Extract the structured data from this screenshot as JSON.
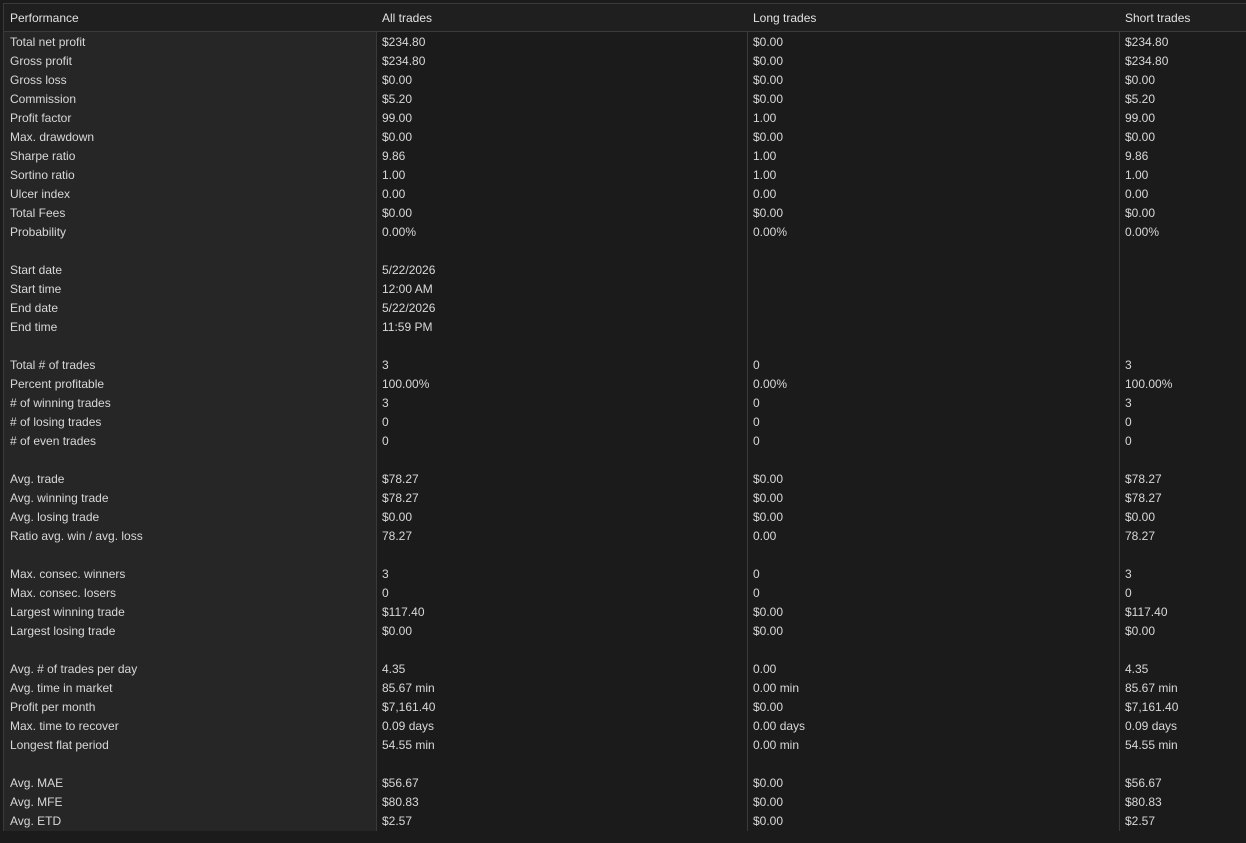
{
  "headers": [
    "Performance",
    "All trades",
    "Long trades",
    "Short trades"
  ],
  "rows": [
    [
      "Total net profit",
      "$234.80",
      "$0.00",
      "$234.80"
    ],
    [
      "Gross profit",
      "$234.80",
      "$0.00",
      "$234.80"
    ],
    [
      "Gross loss",
      "$0.00",
      "$0.00",
      "$0.00"
    ],
    [
      "Commission",
      "$5.20",
      "$0.00",
      "$5.20"
    ],
    [
      "Profit factor",
      "99.00",
      "1.00",
      "99.00"
    ],
    [
      "Max. drawdown",
      "$0.00",
      "$0.00",
      "$0.00"
    ],
    [
      "Sharpe ratio",
      "9.86",
      "1.00",
      "9.86"
    ],
    [
      "Sortino ratio",
      "1.00",
      "1.00",
      "1.00"
    ],
    [
      "Ulcer index",
      "0.00",
      "0.00",
      "0.00"
    ],
    [
      "Total Fees",
      "$0.00",
      "$0.00",
      "$0.00"
    ],
    [
      "Probability",
      "0.00%",
      "0.00%",
      "0.00%"
    ],
    [
      "",
      "",
      "",
      ""
    ],
    [
      "Start date",
      "5/22/2026",
      "",
      ""
    ],
    [
      "Start time",
      "12:00 AM",
      "",
      ""
    ],
    [
      "End date",
      "5/22/2026",
      "",
      ""
    ],
    [
      "End time",
      "11:59 PM",
      "",
      ""
    ],
    [
      "",
      "",
      "",
      ""
    ],
    [
      "Total # of trades",
      "3",
      "0",
      "3"
    ],
    [
      "Percent profitable",
      "100.00%",
      "0.00%",
      "100.00%"
    ],
    [
      "# of winning trades",
      "3",
      "0",
      "3"
    ],
    [
      "# of losing trades",
      "0",
      "0",
      "0"
    ],
    [
      "# of even trades",
      "0",
      "0",
      "0"
    ],
    [
      "",
      "",
      "",
      ""
    ],
    [
      "Avg. trade",
      "$78.27",
      "$0.00",
      "$78.27"
    ],
    [
      "Avg. winning trade",
      "$78.27",
      "$0.00",
      "$78.27"
    ],
    [
      "Avg. losing trade",
      "$0.00",
      "$0.00",
      "$0.00"
    ],
    [
      "Ratio avg. win / avg. loss",
      "78.27",
      "0.00",
      "78.27"
    ],
    [
      "",
      "",
      "",
      ""
    ],
    [
      "Max. consec. winners",
      "3",
      "0",
      "3"
    ],
    [
      "Max. consec. losers",
      "0",
      "0",
      "0"
    ],
    [
      "Largest winning trade",
      "$117.40",
      "$0.00",
      "$117.40"
    ],
    [
      "Largest losing trade",
      "$0.00",
      "$0.00",
      "$0.00"
    ],
    [
      "",
      "",
      "",
      ""
    ],
    [
      "Avg. # of trades per day",
      "4.35",
      "0.00",
      "4.35"
    ],
    [
      "Avg. time in market",
      "85.67 min",
      "0.00 min",
      "85.67 min"
    ],
    [
      "Profit per month",
      "$7,161.40",
      "$0.00",
      "$7,161.40"
    ],
    [
      "Max. time to recover",
      "0.09 days",
      "0.00 days",
      "0.09 days"
    ],
    [
      "Longest flat period",
      "54.55 min",
      "0.00 min",
      "54.55 min"
    ],
    [
      "",
      "",
      "",
      ""
    ],
    [
      "Avg. MAE",
      "$56.67",
      "$0.00",
      "$56.67"
    ],
    [
      "Avg. MFE",
      "$80.83",
      "$0.00",
      "$80.83"
    ],
    [
      "Avg. ETD",
      "$2.57",
      "$0.00",
      "$2.57"
    ]
  ]
}
